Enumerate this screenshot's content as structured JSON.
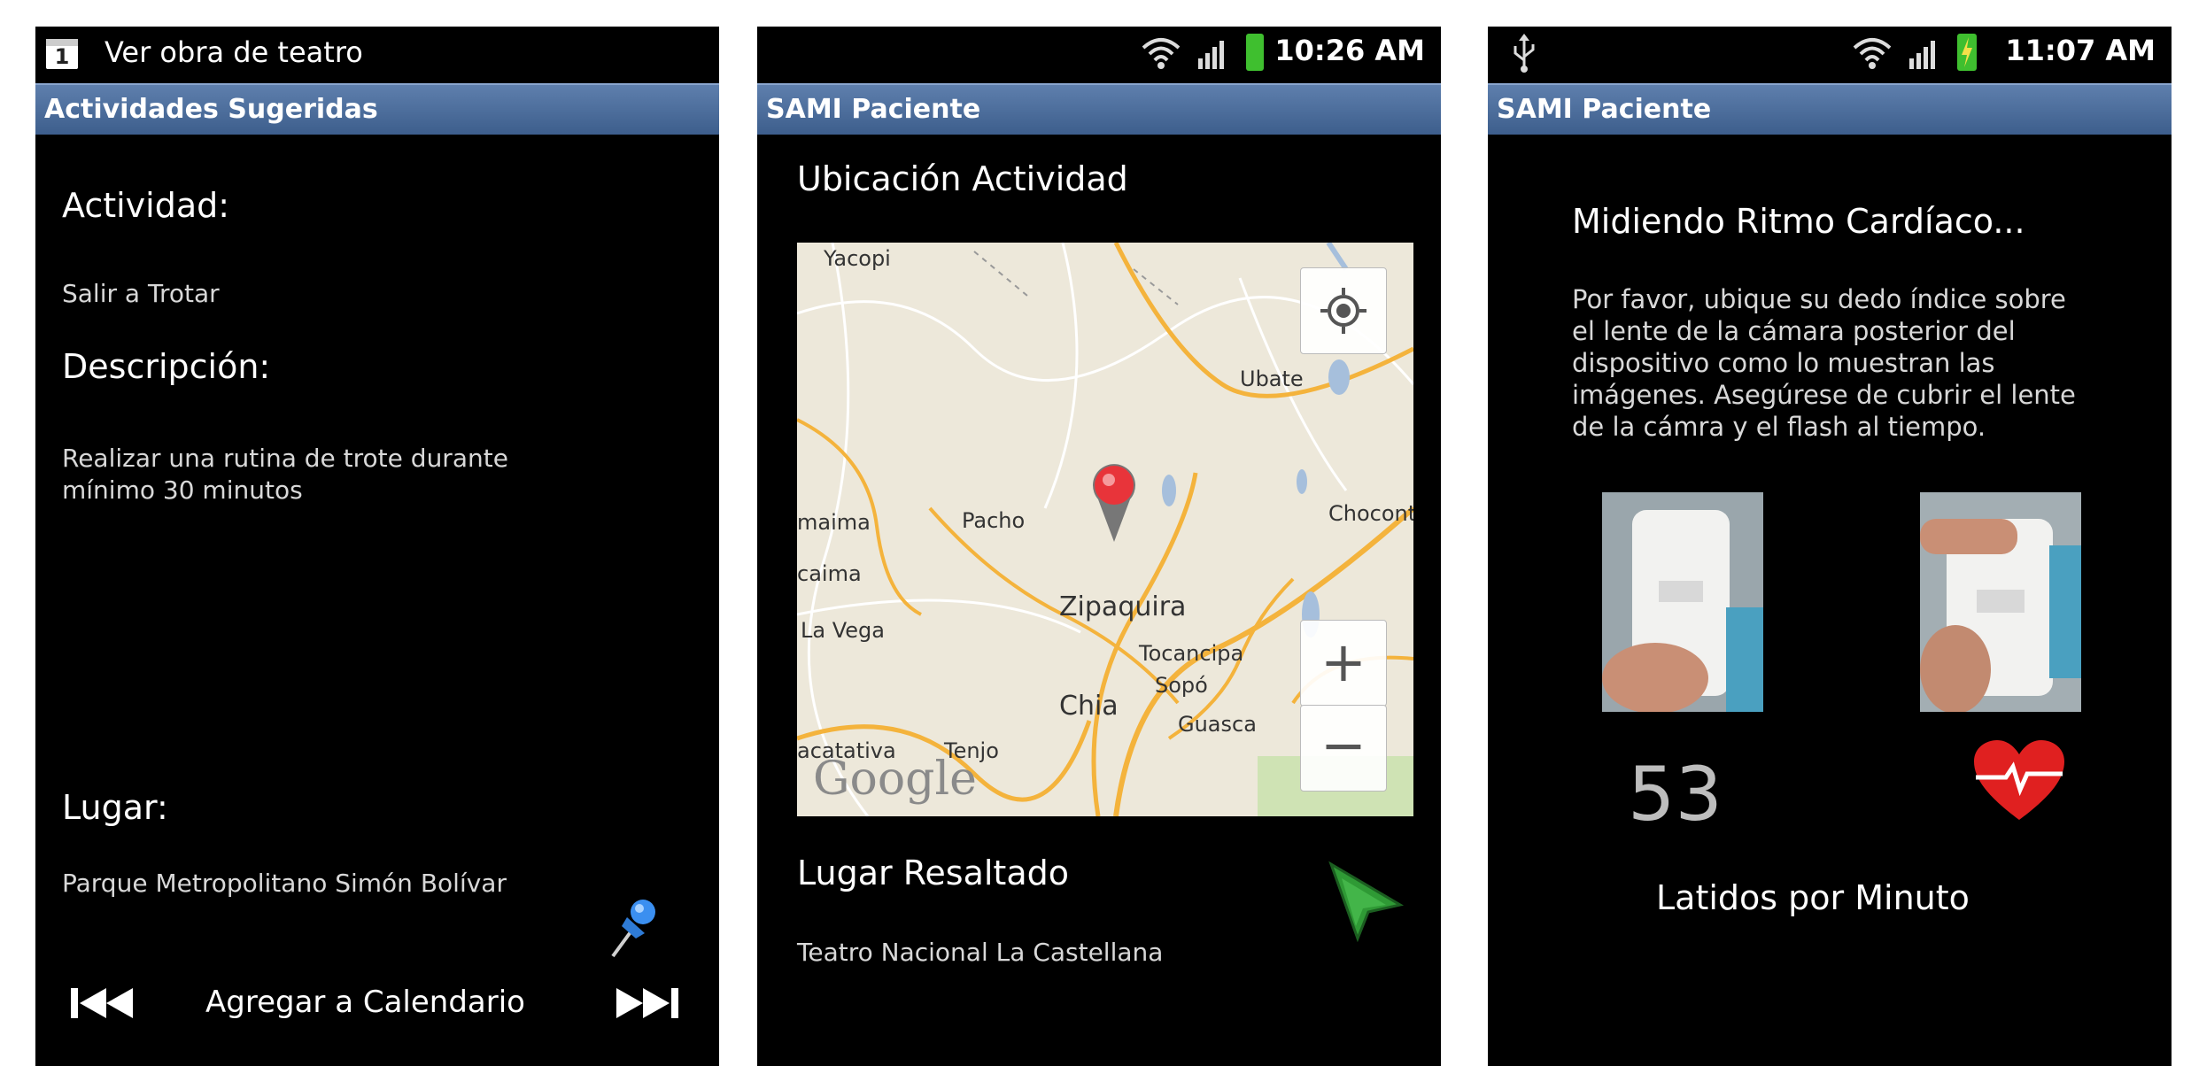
{
  "screen1": {
    "notification_icon": "calendar-icon",
    "notification_icon_text": "1",
    "notification_title": "Ver obra de teatro",
    "title": "Actividades Sugeridas",
    "activity_heading": "Actividad:",
    "activity_value": "Salir a Trotar",
    "description_heading": "Descripción:",
    "description_value": "Realizar una rutina de trote durante mínimo 30 minutos",
    "place_heading": "Lugar:",
    "place_value": "Parque Metropolitano Simón Bolívar",
    "pin_icon": "pushpin-icon",
    "prev_icon": "skip-previous-icon",
    "add_calendar_label": "Agregar a Calendario",
    "next_icon": "skip-next-icon"
  },
  "screen2": {
    "time": "10:26 AM",
    "title": "SAMI Paciente",
    "location_heading": "Ubicación Actividad",
    "map": {
      "labels": {
        "yacopi": "Yacopi",
        "ubate": "Ubate",
        "maima": "maima",
        "pacho": "Pacho",
        "chocont": "Chocont",
        "caima": "caima",
        "zipaquira": "Zipaquira",
        "lavega": "La Vega",
        "tocancipa": "Tocancipa",
        "sopo": "Sopó",
        "chia": "Chia",
        "guasca": "Guasca",
        "acatativa": "acatativa",
        "tenjo": "Tenjo"
      },
      "logo": "Google",
      "zoom_in": "+",
      "zoom_out": "−"
    },
    "highlighted_heading": "Lugar Resaltado",
    "highlighted_value": "Teatro Nacional La Castellana",
    "navigate_icon": "navigation-arrow-icon"
  },
  "screen3": {
    "time": "11:07 AM",
    "usb_icon": "usb-icon",
    "title": "SAMI Paciente",
    "heading": "Midiendo Ritmo Cardíaco...",
    "instructions": "Por favor, ubique su dedo índice sobre el lente de la cámara posterior del dispositivo como lo muestran las imágenes. Asegúrese de cubrir el lente de la cámra y el flash al tiempo.",
    "bpm_value": "53",
    "heart_icon": "heart-pulse-icon",
    "bpm_label": "Latidos por Minuto"
  },
  "colors": {
    "title_bar": "#4a6b9a",
    "battery_green": "#3fbf2f",
    "nav_arrow_green": "#2f9a35",
    "heart_red": "#e02020"
  }
}
